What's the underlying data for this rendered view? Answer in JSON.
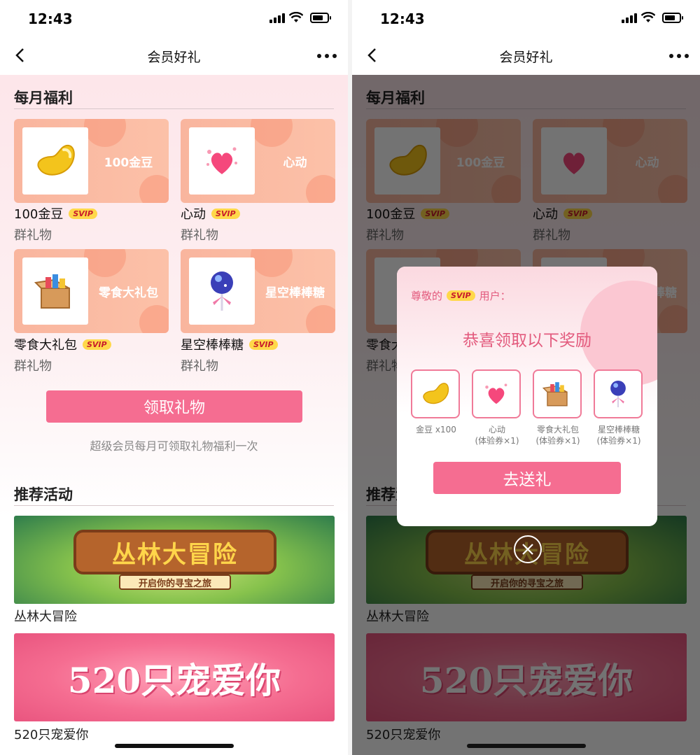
{
  "status_bar": {
    "time": "12:43"
  },
  "nav": {
    "title": "会员好礼"
  },
  "monthly": {
    "title": "每月福利",
    "gifts": [
      {
        "card_label": "100金豆",
        "name": "100金豆",
        "badge": "SVIP",
        "sub": "群礼物",
        "icon": "gold-bean-icon"
      },
      {
        "card_label": "心动",
        "name": "心动",
        "badge": "SVIP",
        "sub": "群礼物",
        "icon": "heart-icon"
      },
      {
        "card_label": "零食大礼包",
        "name": "零食大礼包",
        "badge": "SVIP",
        "sub": "群礼物",
        "icon": "snack-box-icon"
      },
      {
        "card_label": "星空棒棒糖",
        "name": "星空棒棒糖",
        "badge": "SVIP",
        "sub": "群礼物",
        "icon": "lollipop-icon"
      }
    ],
    "claim_button": "领取礼物",
    "note": "超级会员每月可领取礼物福利一次"
  },
  "recommend": {
    "title": "推荐活动",
    "banners": [
      {
        "art_title": "丛林大冒险",
        "art_sub": "开启你的寻宝之旅",
        "label": "丛林大冒险"
      },
      {
        "art_title": "520只宠爱你",
        "label": "520只宠爱你"
      }
    ]
  },
  "popup": {
    "greeting_prefix": "尊敬的",
    "greeting_badge": "SVIP",
    "greeting_suffix": "用户：",
    "headline": "恭喜领取以下奖励",
    "rewards": [
      {
        "line1": "金豆 x100",
        "line2": ""
      },
      {
        "line1": "心动",
        "line2": "(体验券×1)"
      },
      {
        "line1": "零食大礼包",
        "line2": "(体验券×1)"
      },
      {
        "line1": "星空棒棒糖",
        "line2": "(体验券×1)"
      }
    ],
    "action_button": "去送礼"
  },
  "colors": {
    "accent": "#f56d91",
    "badge_bg": "#ffd84a",
    "badge_text": "#c91c2b",
    "card": "#f9b59e"
  }
}
